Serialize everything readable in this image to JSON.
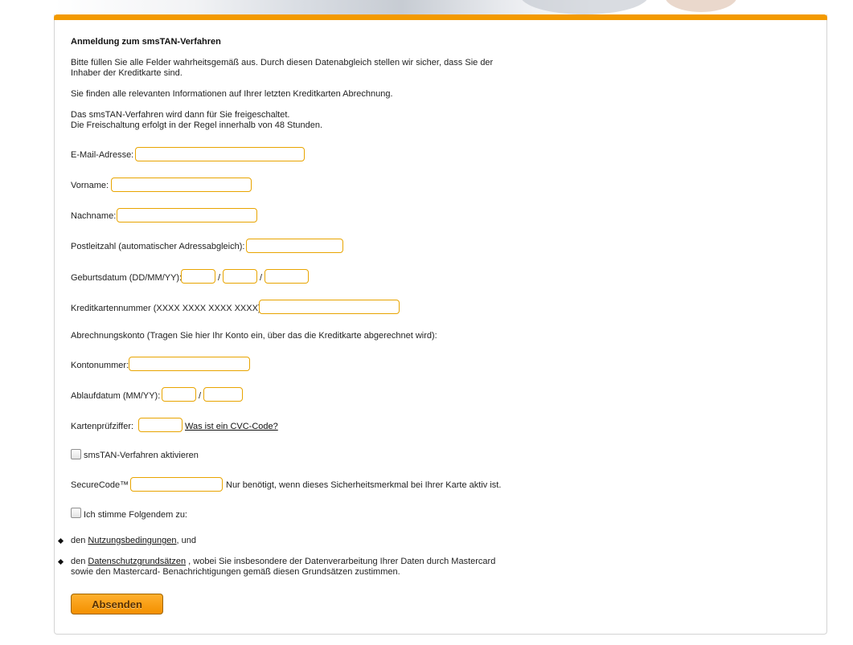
{
  "title": "Anmeldung zum smsTAN-Verfahren",
  "intro": {
    "line1": "Bitte füllen Sie alle Felder wahrheitsgemäß aus. Durch diesen Datenabgleich stellen wir sicher, dass Sie der",
    "line2": "Inhaber der Kreditkarte sind.",
    "line3": "Sie finden alle relevanten Informationen auf Ihrer letzten Kreditkarten Abrechnung.",
    "line4": "Das smsTAN-Verfahren wird dann für Sie freigeschaltet.",
    "line5": "Die Freischaltung erfolgt in der Regel innerhalb von 48 Stunden."
  },
  "fields": {
    "email_label": "E-Mail-Adresse:",
    "email_value": "",
    "vorname_label": "Vorname:",
    "vorname_value": "",
    "nachname_label": "Nachname:",
    "nachname_value": "",
    "plz_label": "Postleitzahl (automatischer Adressabgleich):",
    "plz_value": "",
    "geburtsdatum_label": "Geburtsdatum (DD/MM/YY):",
    "date_separator": "/",
    "kreditkarte_label": "Kreditkartennummer (XXXX XXXX XXXX XXXX):",
    "kreditkarte_value": "",
    "abrechnungskonto_text": "Abrechnungskonto (Tragen Sie hier Ihr Konto ein, über das die Kreditkarte abgerechnet wird):",
    "kontonummer_label": "Kontonummer:",
    "kontonummer_value": "",
    "ablaufdatum_label": "Ablaufdatum (MM/YY):",
    "pruefziffer_label": "Kartenprüfziffer:",
    "cvc_link": "Was ist ein CVC-Code?",
    "smstan_checkbox_label": "smsTAN-Verfahren aktivieren",
    "securecode_label": "SecureCode™",
    "securecode_hint": "Nur benötigt, wenn dieses Sicherheitsmerkmal bei Ihrer Karte aktiv ist.",
    "agree_checkbox_label": "Ich stimme Folgendem zu:"
  },
  "terms": {
    "item1_prefix": "den ",
    "item1_link": "Nutzungsbedingungen",
    "item1_suffix": ", und",
    "item2_prefix": "den ",
    "item2_link": "Datenschutzgrundsätzen",
    "item2_suffix": " , wobei Sie insbesondere der Datenverarbeitung Ihrer Daten durch Mastercard",
    "item2_line2": "sowie den Mastercard- Benachrichtigungen gemäß diesen Grundsätzen zustimmen."
  },
  "submit_label": "Absenden",
  "colors": {
    "accent": "#f39a00",
    "input_border": "#e8a400",
    "panel_border": "#d4d4d4"
  }
}
